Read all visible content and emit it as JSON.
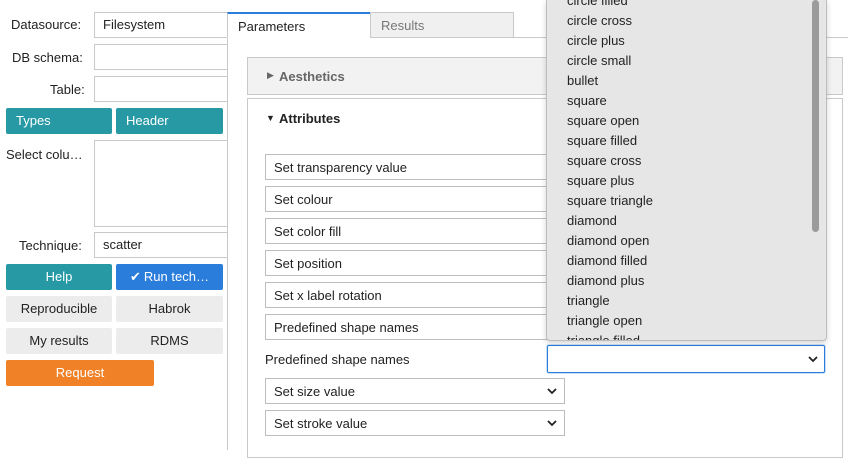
{
  "sidebar": {
    "datasource_label": "Datasource:",
    "datasource_value": "Filesystem",
    "dbschema_label": "DB schema:",
    "dbschema_value": "",
    "table_label": "Table:",
    "table_value": "",
    "types_button": "Types",
    "header_button": "Header",
    "select_columns_label": "Select colu…",
    "technique_label": "Technique:",
    "technique_value": "scatter",
    "help_button": "Help",
    "run_button": "Run tech…",
    "reproducible_button": "Reproducible",
    "habrok_button": "Habrok",
    "my_results_button": "My results",
    "rdms_button": "RDMS",
    "request_button": "Request"
  },
  "tabs": {
    "parameters": "Parameters",
    "results": "Results"
  },
  "sections": {
    "aesthetics": "Aesthetics",
    "attributes": "Attributes"
  },
  "selects": {
    "transparency": "Set transparency value",
    "colour": "Set colour",
    "color_fill": "Set color fill",
    "position": "Set position",
    "x_label_rotation": "Set x label rotation",
    "shape_names": "Predefined shape names",
    "size": "Set size value",
    "stroke": "Set stroke value"
  },
  "shape_field": {
    "label": "Predefined shape names",
    "value": ""
  },
  "dropdown": {
    "options": [
      "circle filled",
      "circle cross",
      "circle plus",
      "circle small",
      "bullet",
      "square",
      "square open",
      "square filled",
      "square cross",
      "square plus",
      "square triangle",
      "diamond",
      "diamond open",
      "diamond filled",
      "diamond plus",
      "triangle",
      "triangle open",
      "triangle filled"
    ]
  },
  "colors": {
    "teal": "#2699a5",
    "blue": "#2a7ddb",
    "orange": "#f08126",
    "grey_button": "#ececec"
  }
}
